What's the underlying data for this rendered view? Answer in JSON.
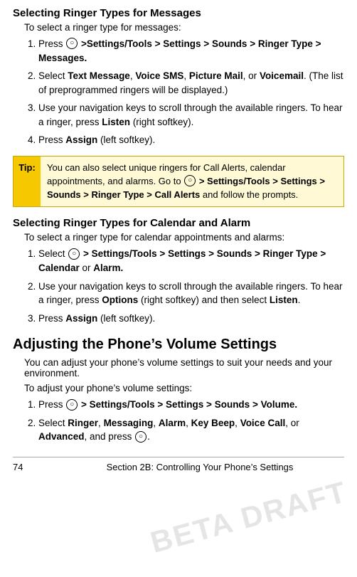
{
  "page": {
    "sections": [
      {
        "id": "ringer-messages",
        "title": "Selecting Ringer Types for Messages",
        "intro": "To select a ringer type for messages:",
        "steps": [
          {
            "num": 1,
            "html": "Press <icon/> <b>>Settings/Tools > Settings > Sounds > Ringer Type > Messages.</b>"
          },
          {
            "num": 2,
            "html": "Select <b>Text Message</b>, <b>Voice SMS</b>, <b>Picture Mail</b>, or <b>Voicemail</b>. (The list of preprogrammed ringers will be displayed.)"
          },
          {
            "num": 3,
            "html": "Use your navigation keys to scroll through the available ringers. To hear a ringer, press <b>Listen</b> (right softkey)."
          },
          {
            "num": 4,
            "html": "Press <b>Assign</b> (left softkey)."
          }
        ],
        "tip": {
          "label": "Tip:",
          "text": "You can also select unique ringers for Call Alerts, calendar appointments, and alarms. Go to <icon/> <b>> Settings/Tools > Settings > Sounds > Ringer Type > Call Alerts</b> and follow the prompts."
        }
      },
      {
        "id": "ringer-calendar",
        "title": "Selecting Ringer Types for Calendar and Alarm",
        "intro": "To select a ringer type for calendar appointments and alarms:",
        "steps": [
          {
            "num": 1,
            "html": "Select <icon/> <b>> Settings/Tools > Settings > Sounds > Ringer Type > Calendar</b> or <b>Alarm.</b>"
          },
          {
            "num": 2,
            "html": "Use your navigation keys to scroll through the available ringers. To hear a ringer, press <b>Options</b> (right softkey) and then select <b>Listen</b>."
          },
          {
            "num": 3,
            "html": "Press <b>Assign</b> (left softkey)."
          }
        ]
      },
      {
        "id": "volume-settings",
        "title": "Adjusting the Phone’s Volume Settings",
        "intro": "You can adjust your phone’s volume settings to suit your needs and your environment.",
        "intro2": "To adjust your phone’s volume settings:",
        "steps": [
          {
            "num": 1,
            "html": "Press <icon/> <b>> Settings/Tools > Settings > Sounds > Volume.</b>"
          },
          {
            "num": 2,
            "html": "Select <b>Ringer</b>, <b>Messaging</b>, <b>Alarm</b>, <b>Key Beep</b>, <b>Voice Call</b>, or <b>Advanced</b>, and press <icon/>."
          }
        ]
      }
    ],
    "footer": {
      "page": "74",
      "text": "Section 2B: Controlling Your Phone’s Settings"
    },
    "watermark": "BETA DRAFT"
  }
}
